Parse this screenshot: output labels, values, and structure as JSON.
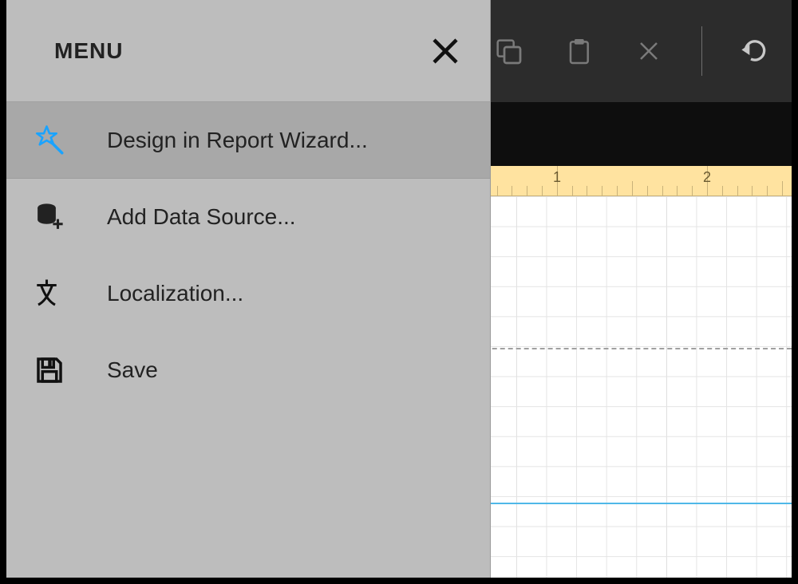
{
  "menu": {
    "title": "MENU",
    "items": [
      {
        "label": "Design in Report Wizard...",
        "icon": "wizard-star-icon",
        "highlighted": true
      },
      {
        "label": "Add Data Source...",
        "icon": "data-source-icon"
      },
      {
        "label": "Localization...",
        "icon": "localization-icon"
      },
      {
        "label": "Save",
        "icon": "save-icon"
      }
    ]
  },
  "toolbar": {
    "buttons": [
      "copy",
      "paste",
      "delete",
      "undo"
    ]
  },
  "ruler": {
    "marks": [
      "1",
      "2"
    ]
  }
}
